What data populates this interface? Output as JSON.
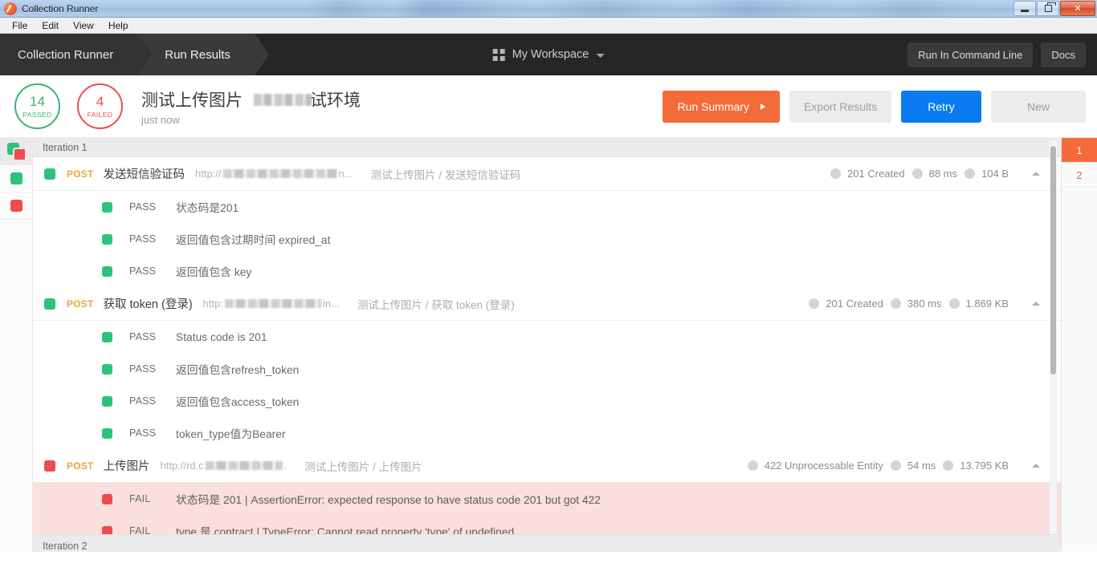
{
  "window": {
    "title": "Collection Runner",
    "app_icon": "postman-icon",
    "controls": {
      "minimize": "minimize-icon",
      "restore": "restore-icon",
      "close": "✕"
    }
  },
  "menubar": {
    "items": [
      "File",
      "Edit",
      "View",
      "Help"
    ]
  },
  "navbar": {
    "breadcrumbs": [
      {
        "label": "Collection Runner"
      },
      {
        "label": "Run Results"
      }
    ],
    "workspace": {
      "icon": "grid-icon",
      "label": "My Workspace",
      "caret": "chevron-down-icon"
    },
    "buttons": [
      {
        "label": "Run In Command Line"
      },
      {
        "label": "Docs"
      }
    ]
  },
  "summary": {
    "passed": {
      "count": "14",
      "label": "PASSED",
      "color": "#3bb273"
    },
    "failed": {
      "count": "4",
      "label": "FAILED",
      "color": "#ef4c4c"
    },
    "title": "测试上传图片",
    "title_suffix": "试环境",
    "timestamp": "just now",
    "actions": {
      "run_summary": "Run Summary",
      "export_results": "Export Results",
      "retry": "Retry",
      "new": "New"
    }
  },
  "filter_rail": {
    "items": [
      {
        "name": "filter-all",
        "type": "all",
        "active": true
      },
      {
        "name": "filter-passed",
        "type": "pass",
        "active": false
      },
      {
        "name": "filter-failed",
        "type": "fail",
        "active": false
      }
    ]
  },
  "results": {
    "iteration_header": "Iteration 1",
    "next_iteration_header": "Iteration 2",
    "requests": [
      {
        "status": "pass",
        "method": "POST",
        "name": "发送短信验证码",
        "url_prefix": "http://",
        "url_suffix": "n...",
        "path": "测试上传图片 / 发送短信验证码",
        "code": "201 Created",
        "time": "88 ms",
        "size": "104 B",
        "tests": [
          {
            "result": "PASS",
            "name": "状态码是201"
          },
          {
            "result": "PASS",
            "name": "返回值包含过期时间 expired_at"
          },
          {
            "result": "PASS",
            "name": "返回值包含 key"
          }
        ]
      },
      {
        "status": "pass",
        "method": "POST",
        "name": "获取 token (登录)",
        "url_prefix": "http:",
        "url_suffix": "in...",
        "path": "测试上传图片 / 获取 token (登录)",
        "code": "201 Created",
        "time": "380 ms",
        "size": "1.869 KB",
        "tests": [
          {
            "result": "PASS",
            "name": "Status code is 201"
          },
          {
            "result": "PASS",
            "name": "返回值包含refresh_token"
          },
          {
            "result": "PASS",
            "name": "返回值包含access_token"
          },
          {
            "result": "PASS",
            "name": "token_type值为Bearer"
          }
        ]
      },
      {
        "status": "fail",
        "method": "POST",
        "name": "上传图片",
        "url_prefix": "http://rd.c",
        "url_suffix": ".",
        "path": "测试上传图片 / 上传图片",
        "code": "422 Unprocessable Entity",
        "time": "54 ms",
        "size": "13.795 KB",
        "tests": [
          {
            "result": "FAIL",
            "name": "状态码是 201 | AssertionError: expected response to have status code 201 but got 422"
          },
          {
            "result": "FAIL",
            "name": "type 是 contract | TypeError: Cannot read property 'type' of undefined"
          }
        ]
      }
    ]
  },
  "pager": {
    "items": [
      {
        "label": "1",
        "active": true
      },
      {
        "label": "2",
        "active": false
      }
    ]
  }
}
